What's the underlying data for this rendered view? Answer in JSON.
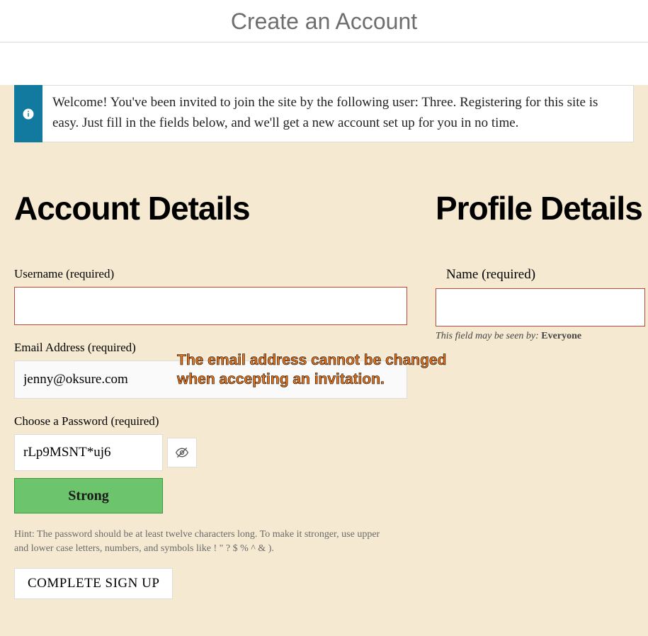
{
  "page_title": "Create an Account",
  "info_message": "Welcome! You've been invited to join the site by the following user: Three. Registering for this site is easy. Just fill in the fields below, and we'll get a new account set up for you in no time.",
  "account": {
    "heading": "Account Details",
    "username_label": "Username (required)",
    "username_value": "",
    "email_label": "Email Address (required)",
    "email_value": "jenny@oksure.com",
    "password_label": "Choose a Password (required)",
    "password_value": "rLp9MSNT*uj6",
    "strength_label": "Strong",
    "hint": "Hint: The password should be at least twelve characters long. To make it stronger, use upper and lower case letters, numbers, and symbols like ! \" ? $ % ^ & ).",
    "submit_label": "COMPLETE SIGN UP"
  },
  "profile": {
    "heading": "Profile Details",
    "name_label": "Name (required)",
    "name_value": "",
    "visibility_prefix": "This field may be seen by: ",
    "visibility_value": "Everyone"
  },
  "overlay": {
    "line1": "The email address cannot be changed",
    "line2": "when accepting an invitation."
  }
}
